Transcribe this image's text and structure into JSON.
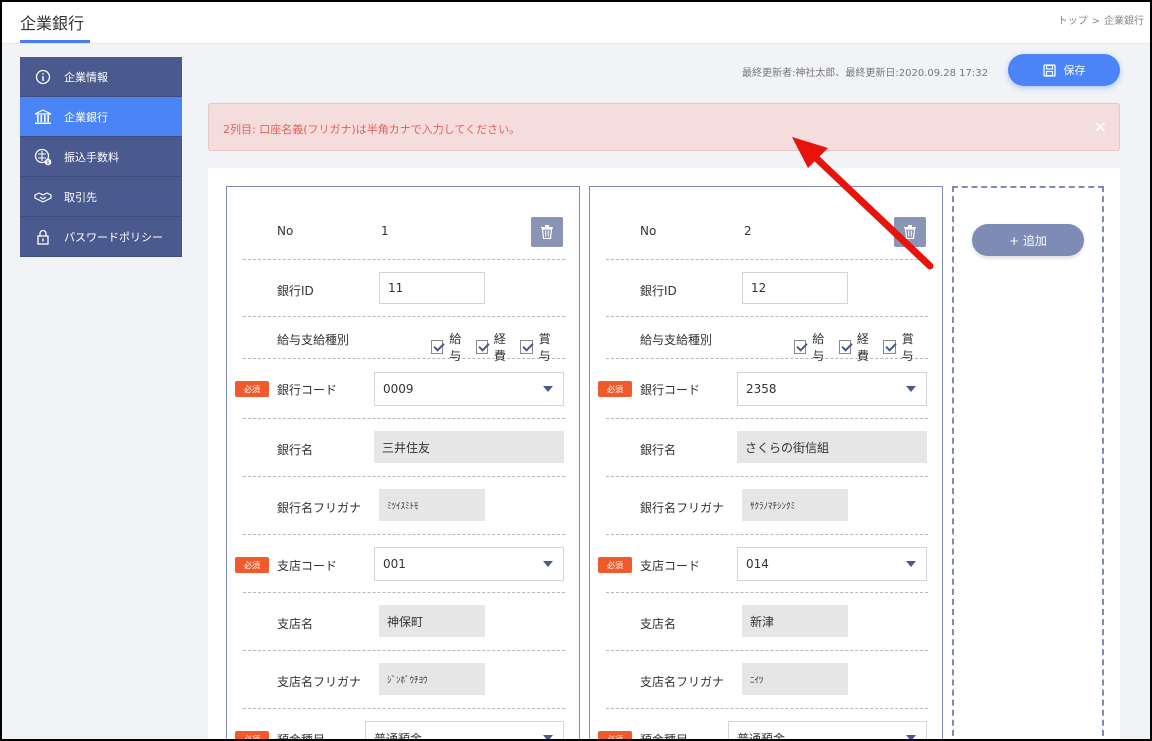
{
  "header": {
    "title": "企業銀行",
    "breadcrumb": [
      "トップ",
      ">",
      "企業銀行"
    ]
  },
  "sidebar": {
    "items": [
      {
        "label": "企業情報",
        "icon": "info-icon"
      },
      {
        "label": "企業銀行",
        "icon": "bank-icon",
        "active": true
      },
      {
        "label": "振込手数料",
        "icon": "fee-icon"
      },
      {
        "label": "取引先",
        "icon": "handshake-icon"
      },
      {
        "label": "パスワードポリシー",
        "icon": "lock-icon"
      }
    ]
  },
  "meta": {
    "updated": "最終更新者:神社太郎、最終更新日:2020.09.28 17:32"
  },
  "toolbar": {
    "save_label": "保存",
    "add_label": "+ 追加"
  },
  "alert": {
    "message": "2列目: 口座名義(フリガナ)は半角カナで入力してください。",
    "close": "×"
  },
  "labels": {
    "no": "No",
    "bank_id": "銀行ID",
    "pay_type": "給与支給種別",
    "bank_code": "銀行コード",
    "bank_name": "銀行名",
    "bank_kana": "銀行名フリガナ",
    "branch_code": "支店コード",
    "branch_name": "支店名",
    "branch_kana": "支店名フリガナ",
    "deposit_type": "預金種目",
    "required": "必須",
    "check_salary": "給与",
    "check_expense": "経費",
    "check_bonus": "賞与"
  },
  "cards": [
    {
      "no": "1",
      "bank_id": "11",
      "bank_code": "0009",
      "bank_name": "三井住友",
      "bank_kana": "ﾐﾂｲｽﾐﾄﾓ",
      "branch_code": "001",
      "branch_name": "神保町",
      "branch_kana": "ｼﾞﾝﾎﾞｳﾁﾖｳ",
      "deposit_type": "普通預金"
    },
    {
      "no": "2",
      "bank_id": "12",
      "bank_code": "2358",
      "bank_name": "さくらの街信組",
      "bank_kana": "ｻｸﾗﾉﾏﾁｼﾝｸﾐ",
      "branch_code": "014",
      "branch_name": "新津",
      "branch_kana": "ﾆｲﾂ",
      "deposit_type": "普通預金"
    }
  ],
  "colors": {
    "accent": "#4a84f6",
    "sidebar": "#4a5a8f",
    "required": "#f15a2b",
    "alert_text": "#e0635a",
    "arrow": "#e8140c"
  }
}
